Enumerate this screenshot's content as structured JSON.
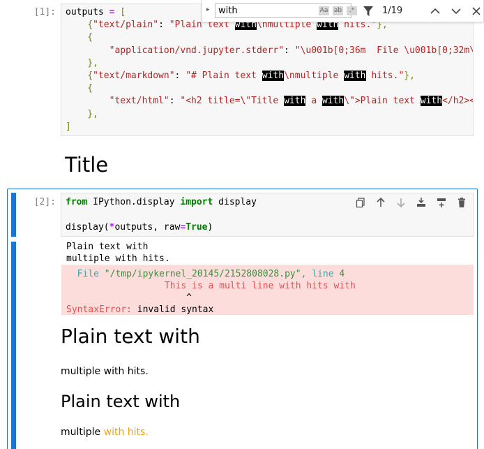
{
  "cell1": {
    "prompt": "[1]:",
    "lines": [
      [
        {
          "t": "outputs ",
          "c": "p"
        },
        {
          "t": "=",
          "c": "o"
        },
        {
          "t": " [",
          "c": "brk"
        }
      ],
      [
        {
          "t": "    ",
          "c": "p"
        },
        {
          "t": "{",
          "c": "brk"
        },
        {
          "t": "\"text/plain\"",
          "c": "s"
        },
        {
          "t": ": ",
          "c": "p"
        },
        {
          "t": "\"Plain text ",
          "c": "s"
        },
        {
          "t": "with",
          "c": "hl"
        },
        {
          "t": "\\nmultiple ",
          "c": "s"
        },
        {
          "t": "with",
          "c": "hl"
        },
        {
          "t": " hits.\"",
          "c": "s"
        },
        {
          "t": "},",
          "c": "brk"
        }
      ],
      [
        {
          "t": "    {",
          "c": "brk"
        }
      ],
      [
        {
          "t": "        ",
          "c": "p"
        },
        {
          "t": "\"application/vnd.jupyter.stderr\"",
          "c": "s"
        },
        {
          "t": ": ",
          "c": "p"
        },
        {
          "t": "\"\\u001b[0;36m  File \\u001b[0;32m\\",
          "c": "s"
        }
      ],
      [
        {
          "t": "    },",
          "c": "brk"
        }
      ],
      [
        {
          "t": "    ",
          "c": "p"
        },
        {
          "t": "{",
          "c": "brk"
        },
        {
          "t": "\"text/markdown\"",
          "c": "s"
        },
        {
          "t": ": ",
          "c": "p"
        },
        {
          "t": "\"# Plain text ",
          "c": "s"
        },
        {
          "t": "with",
          "c": "hl"
        },
        {
          "t": "\\nmultiple ",
          "c": "s"
        },
        {
          "t": "with",
          "c": "hl"
        },
        {
          "t": " hits.\"",
          "c": "s"
        },
        {
          "t": "},",
          "c": "brk"
        }
      ],
      [
        {
          "t": "    {",
          "c": "brk"
        }
      ],
      [
        {
          "t": "        ",
          "c": "p"
        },
        {
          "t": "\"text/html\"",
          "c": "s"
        },
        {
          "t": ": ",
          "c": "p"
        },
        {
          "t": "\"<h2 title=\\\"Title ",
          "c": "s"
        },
        {
          "t": "with",
          "c": "hl"
        },
        {
          "t": " a ",
          "c": "s"
        },
        {
          "t": "with",
          "c": "hl"
        },
        {
          "t": "\\\">Plain text ",
          "c": "s"
        },
        {
          "t": "with",
          "c": "hl"
        },
        {
          "t": "</h2><",
          "c": "s"
        }
      ],
      [
        {
          "t": "    },",
          "c": "brk"
        }
      ],
      [
        {
          "t": "]",
          "c": "brk"
        }
      ]
    ]
  },
  "search": {
    "query": "with",
    "match_case_label": "Aa",
    "whole_word_label": "ab",
    "regex_label": ".*",
    "match_count": "1/19"
  },
  "markdown_title": "Title",
  "cell2": {
    "prompt": "[2]:",
    "lines": [
      [
        {
          "t": "from",
          "c": "k"
        },
        {
          "t": " IPython.display ",
          "c": "p"
        },
        {
          "t": "import",
          "c": "k"
        },
        {
          "t": " display",
          "c": "p"
        }
      ],
      [
        {
          "t": "",
          "c": "p"
        }
      ],
      [
        {
          "t": "display(",
          "c": "p"
        },
        {
          "t": "*",
          "c": "o"
        },
        {
          "t": "outputs, raw",
          "c": "p"
        },
        {
          "t": "=",
          "c": "o"
        },
        {
          "t": "True",
          "c": "k"
        },
        {
          "t": ")",
          "c": "p"
        }
      ]
    ],
    "stream_line1": "Plain text with",
    "stream_line2": "multiple with hits.",
    "err": {
      "file_label": "  File ",
      "file_path": "\"/tmp/ipykernel_20145/2152808028.py\"",
      "sep": ", ",
      "line_label": "line ",
      "line_no": "4",
      "code_line": "                  This is a multi line with hits with",
      "caret": "                      ^",
      "err_name": "SyntaxError:",
      "err_msg": " invalid syntax"
    },
    "md_h1": "Plain text with",
    "md_p": "multiple with hits.",
    "html_h2": "Plain text with",
    "html_p_plain": "multiple ",
    "html_p_orange": "with hits."
  }
}
